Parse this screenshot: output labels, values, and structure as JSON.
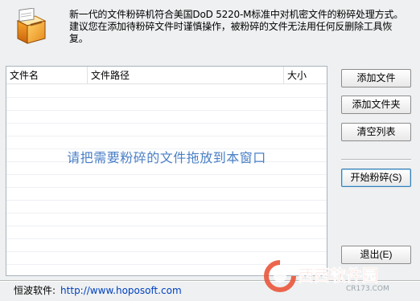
{
  "header": {
    "description": "新一代的文件粉碎机符合美国DoD 5220-M标准中对机密文件的粉碎处理方式。建议您在添加待粉碎文件时谨慎操作，被粉碎的文件无法用任何反删除工具恢复。"
  },
  "file_list": {
    "columns": [
      "文件名",
      "文件路径",
      "大小"
    ],
    "drop_hint": "请把需要粉碎的文件拖放到本窗口"
  },
  "buttons": {
    "add_file": "添加文件",
    "add_folder": "添加文件夹",
    "clear_list": "清空列表",
    "start_shred": "开始粉碎(S)",
    "exit": "退出(E)"
  },
  "footer": {
    "label": "恒波软件:",
    "url": "http://www.hoposoft.com"
  },
  "watermark": {
    "name": "西西软件园",
    "site": "CR173.COM"
  },
  "colors": {
    "hint": "#4a7fc6",
    "link": "#0040c0",
    "watermark": "#e9553a"
  }
}
